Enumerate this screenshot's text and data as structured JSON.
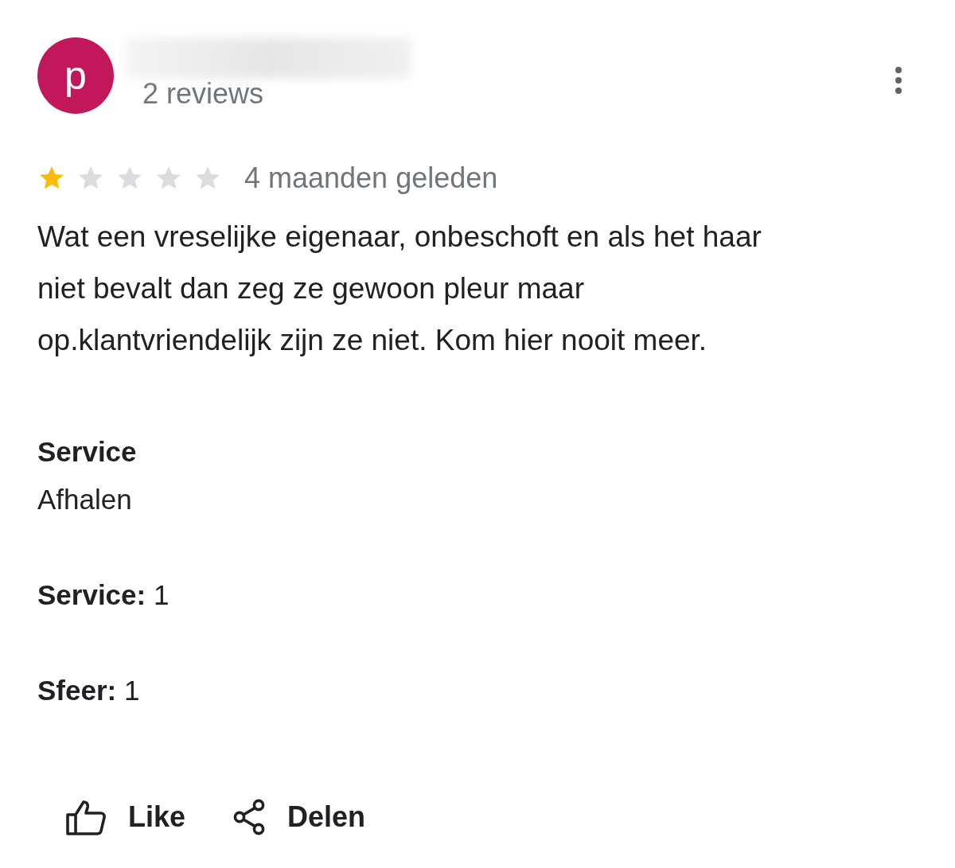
{
  "reviewer": {
    "initial": "p",
    "review_count": "2 reviews"
  },
  "rating": {
    "stars": 1,
    "time": "4 maanden geleden"
  },
  "text": "Wat een vreselijke eigenaar, onbeschoft en als het haar niet bevalt dan zeg ze gewoon pleur maar op.klantvriendelijk zijn ze niet. Kom hier nooit meer.",
  "service": {
    "label": "Service",
    "value": "Afhalen"
  },
  "scores": [
    "**Service:** 1",
    "**Sfeer:** 1"
  ],
  "actions": [
    {
      "kind": "like",
      "label": "Like"
    },
    {
      "kind": "share",
      "label": "Delen"
    }
  ]
}
